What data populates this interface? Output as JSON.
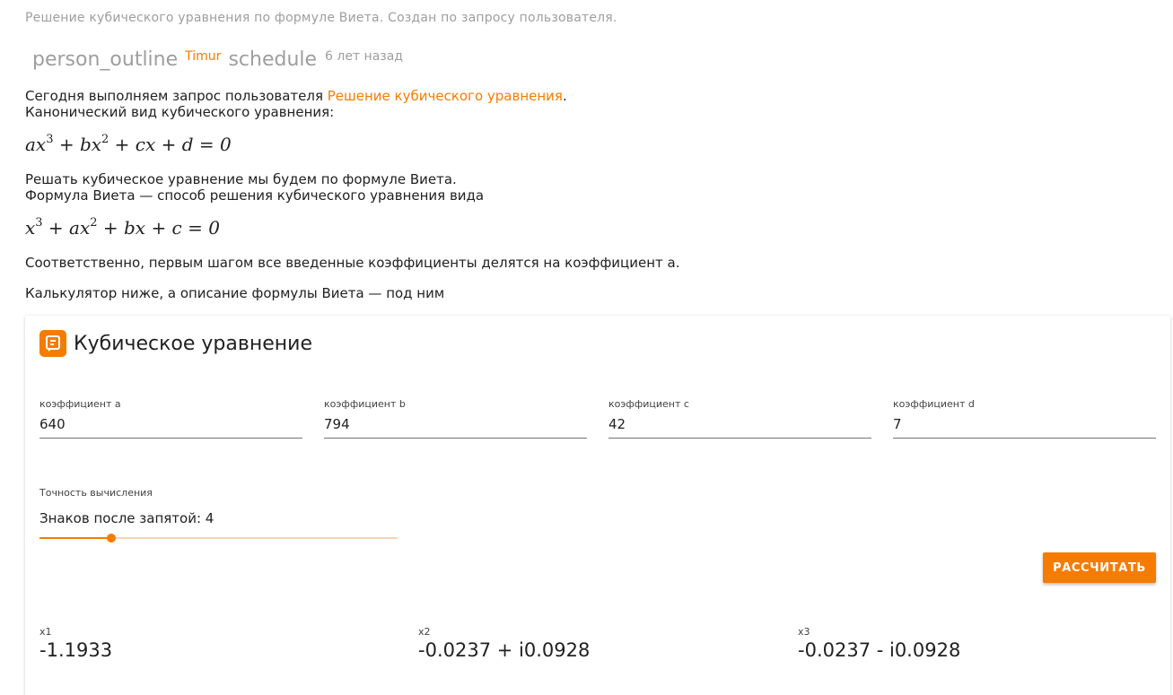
{
  "header": {
    "subtitle": "Решение кубического уравнения по формуле Виета. Создан по запросу пользователя.",
    "author_icon": "person_outline",
    "author": "Timur",
    "time_icon": "schedule",
    "time": "6 лет назад"
  },
  "article": {
    "p1_before": "Сегодня выполняем запрос пользователя ",
    "p1_link": "Решение кубического уравнения",
    "p1_after": ".",
    "p2": "Канонический вид кубического уравнения:",
    "formula1": {
      "f1_a": "ax",
      "f1_e1": "3",
      "f1_b": " + bx",
      "f1_e2": "2",
      "f1_c": " + cx + d = 0"
    },
    "p3": "Решать кубическое уравнение мы будем по формуле Виета.",
    "p4": "Формула Виета — способ решения кубического уравнения вида",
    "formula2": {
      "f2_a": "x",
      "f2_e1": "3",
      "f2_b": " + ax",
      "f2_e2": "2",
      "f2_c": " + bx + c = 0"
    },
    "p5": "Соответственно, первым шагом все введенные коэффициенты делятся на коэффициент a.",
    "p6": "Калькулятор ниже, а описание формулы Виета — под ним"
  },
  "calculator": {
    "icon": "calculator-icon",
    "title": "Кубическое уравнение",
    "fields": [
      {
        "label": "коэффициент a",
        "value": "640"
      },
      {
        "label": "коэффициент b",
        "value": "794"
      },
      {
        "label": "коэффициент c",
        "value": "42"
      },
      {
        "label": "коэффициент d",
        "value": "7"
      }
    ],
    "precision": {
      "label": "Точность вычисления",
      "value_text": "Знаков после запятой: 4",
      "level": 0.2
    },
    "button": "РАССЧИТАТЬ",
    "results": [
      {
        "label": "x1",
        "value": "-1.1933"
      },
      {
        "label": "x2",
        "value": "-0.0237 + i0.0928"
      },
      {
        "label": "x3",
        "value": "-0.0237 - i0.0928"
      }
    ]
  },
  "colors": {
    "accent": "#f57c00",
    "muted": "#9e9e9e",
    "text": "#212121"
  }
}
